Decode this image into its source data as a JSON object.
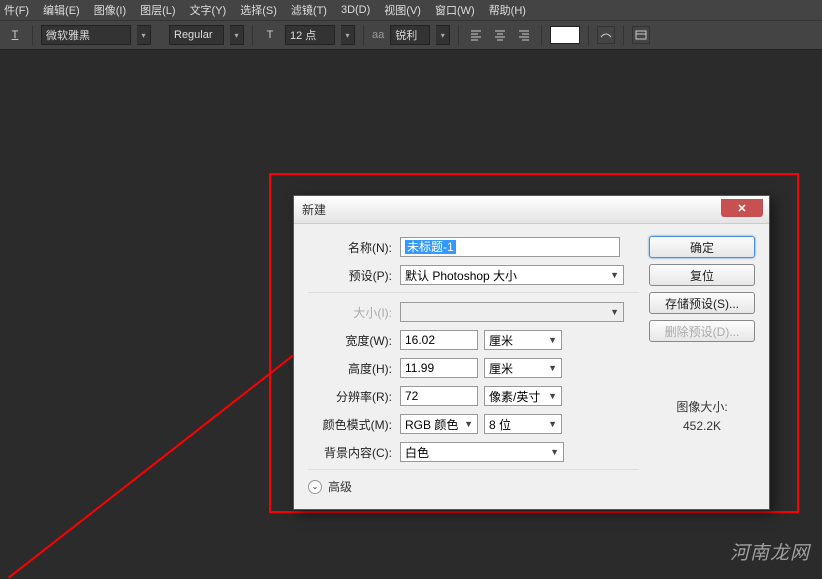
{
  "menubar": {
    "items": [
      "件(F)",
      "编辑(E)",
      "图像(I)",
      "图层(L)",
      "文字(Y)",
      "选择(S)",
      "滤镜(T)",
      "3D(D)",
      "视图(V)",
      "窗口(W)",
      "帮助(H)"
    ]
  },
  "toolbar": {
    "font": "微软雅黑",
    "style": "Regular",
    "size": "12 点",
    "aa_label": "aa",
    "sharpness": "锐利",
    "text_icon": "T"
  },
  "dialog": {
    "title": "新建",
    "name_label": "名称(N):",
    "name_value": "未标题-1",
    "preset_label": "预设(P):",
    "preset_value": "默认 Photoshop 大小",
    "size_label": "大小(I):",
    "width_label": "宽度(W):",
    "width_value": "16.02",
    "width_unit": "厘米",
    "height_label": "高度(H):",
    "height_value": "11.99",
    "height_unit": "厘米",
    "res_label": "分辨率(R):",
    "res_value": "72",
    "res_unit": "像素/英寸",
    "mode_label": "颜色模式(M):",
    "mode_value": "RGB 颜色",
    "mode_bit": "8 位",
    "bg_label": "背景内容(C):",
    "bg_value": "白色",
    "advanced": "高级",
    "ok": "确定",
    "reset": "复位",
    "save_preset": "存储预设(S)...",
    "del_preset": "删除预设(D)...",
    "img_size_label": "图像大小:",
    "img_size_value": "452.2K"
  },
  "watermark": "河南龙网"
}
